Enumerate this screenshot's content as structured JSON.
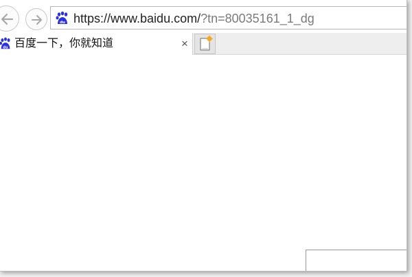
{
  "browser": {
    "address_bar": {
      "url_main": "https://www.baidu.com/",
      "url_query": "?tn=80035161_1_dg",
      "site_icon": "baidu-paw-icon"
    },
    "nav": {
      "back_icon": "back-arrow-icon",
      "forward_icon": "forward-arrow-icon"
    },
    "tab": {
      "title": "百度一下，你就知道",
      "close_label": "×",
      "icon": "baidu-paw-icon"
    },
    "new_tab_icon": "new-tab-icon"
  },
  "colors": {
    "baidu_blue": "#2932e1",
    "new_tab_star": "#f5a623"
  }
}
